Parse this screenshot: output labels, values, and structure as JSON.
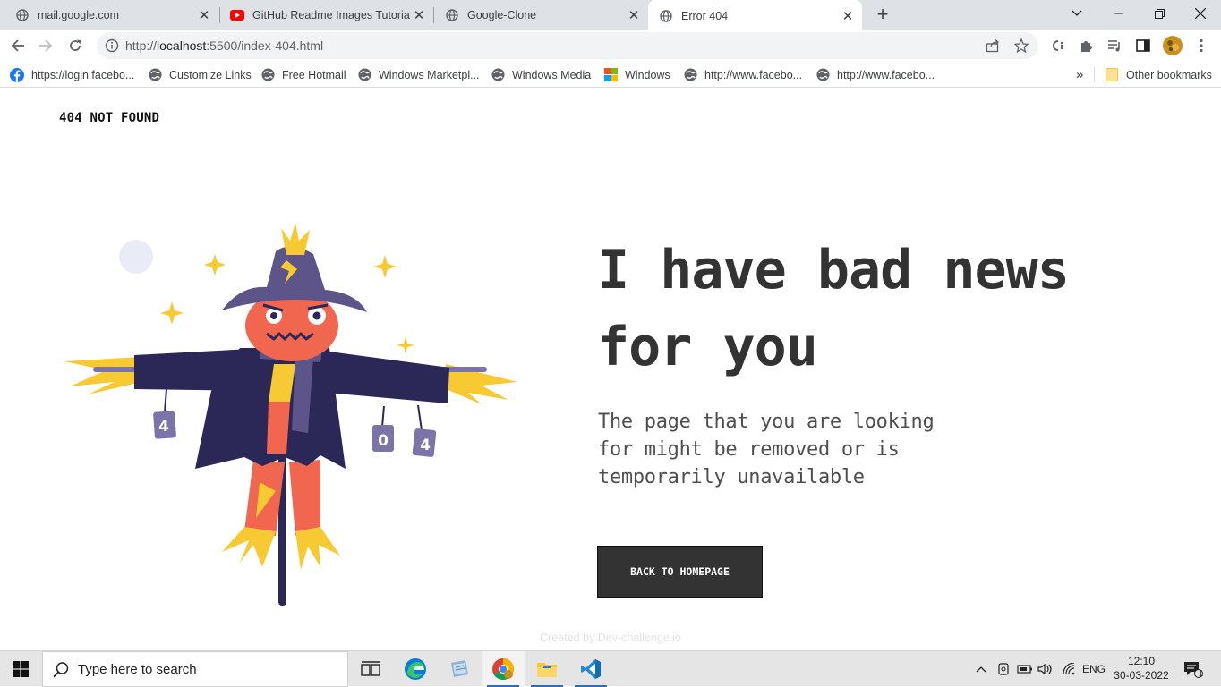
{
  "browser": {
    "tabs": [
      {
        "title": "mail.google.com",
        "favicon": "globe-icon"
      },
      {
        "title": "GitHub Readme Images Tutorial (",
        "favicon": "youtube-icon"
      },
      {
        "title": "Google-Clone",
        "favicon": "globe-icon"
      },
      {
        "title": "Error 404",
        "favicon": "globe-icon",
        "active": true
      }
    ],
    "new_tab": "+",
    "address": {
      "protocol": "http://",
      "host": "localhost",
      "path": ":5500/index-404.html"
    },
    "bookmarks": [
      {
        "label": "https://login.facebo...",
        "icon": "facebook-icon"
      },
      {
        "label": "Customize Links",
        "icon": "globe-icon"
      },
      {
        "label": "Free Hotmail",
        "icon": "globe-icon"
      },
      {
        "label": "Windows Marketpl...",
        "icon": "globe-icon"
      },
      {
        "label": "Windows Media",
        "icon": "globe-icon"
      },
      {
        "label": "Windows",
        "icon": "windows-logo-icon"
      },
      {
        "label": "http://www.facebo...",
        "icon": "globe-icon"
      },
      {
        "label": "http://www.facebo...",
        "icon": "globe-icon"
      }
    ],
    "bookmarks_overflow": "»",
    "other_bookmarks": "Other bookmarks"
  },
  "page": {
    "brand": "404 NOT FOUND",
    "headline": "I have bad news for you",
    "subtext": "The page that you are looking for might be removed or is temporarily unavailable",
    "button": "BACK TO HOMEPAGE",
    "credit": "Created by Dev-challenge.io",
    "illustration": {
      "can_labels": [
        "4",
        "0",
        "4"
      ]
    }
  },
  "taskbar": {
    "search_placeholder": "Type here to search",
    "language": "ENG",
    "time": "12:10",
    "date": "30-03-2022",
    "notification_count": "1"
  },
  "colors": {
    "button_bg": "#333333",
    "headline": "#333333",
    "scarecrow_hat": "#5d5589",
    "scarecrow_coat": "#2b2857",
    "scarecrow_face": "#f0664f",
    "straw": "#f7c933"
  }
}
